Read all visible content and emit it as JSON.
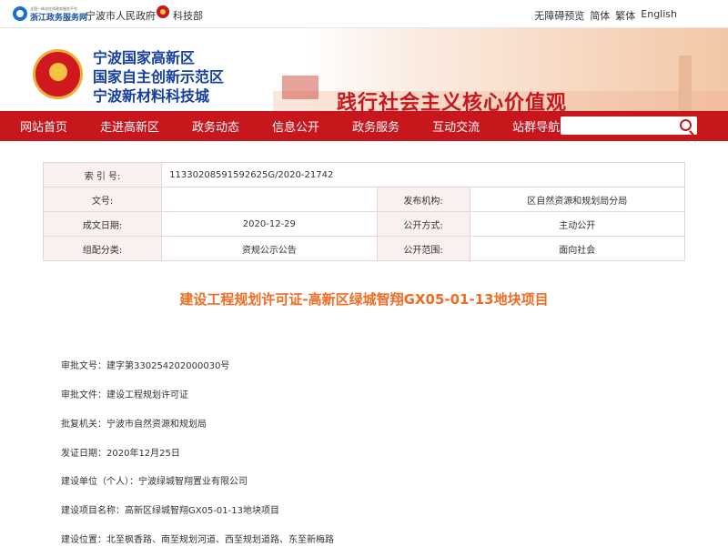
{
  "topbar": {
    "zj_small": "全国一体化在线政务服务平台",
    "zj_name": "浙江政务服务网",
    "link_city": "宁波市人民政府",
    "link_ministry": "科技部",
    "right_links": [
      "无障碍预览",
      "简体",
      "繁体",
      "English"
    ]
  },
  "banner": {
    "title_lines": [
      "宁波国家高新区",
      "国家自主创新示范区",
      "宁波新材料科技城"
    ],
    "slogan": "践行社会主义核心价值观"
  },
  "nav": {
    "items": [
      "网站首页",
      "走进高新区",
      "政务动态",
      "信息公开",
      "政务服务",
      "互动交流",
      "站群导航"
    ],
    "search_placeholder": ""
  },
  "info": {
    "index_label": "索 引 号:",
    "index_value": "11330208591592625G/2020-21742",
    "doc_label": "文号:",
    "doc_value": "",
    "org_label": "发布机构:",
    "org_value": "区自然资源和规划局分局",
    "date_label": "成文日期:",
    "date_value": "2020-12-29",
    "method_label": "公开方式:",
    "method_value": "主动公开",
    "category_label": "组配分类:",
    "category_value": "资规公示公告",
    "scope_label": "公开范围:",
    "scope_value": "面向社会"
  },
  "article": {
    "title": "建设工程规划许可证-高新区绿城智翔GX05-01-13地块项目",
    "fields": [
      "审批文号：建字第330254202000030号",
      "审批文件：建设工程规划许可证",
      "批复机关：宁波市自然资源和规划局",
      "发证日期：2020年12月25日",
      "建设单位（个人）：宁波绿城智翔置业有限公司",
      "建设项目名称：高新区绿城智翔GX05-01-13地块项目",
      "建设位置：北至枫香路、南至规划河道、西至规划道路、东至新梅路"
    ]
  },
  "colors": {
    "nav_red": "#c8161d",
    "title_orange": "#f26b21",
    "brand_blue": "#1540a0"
  }
}
